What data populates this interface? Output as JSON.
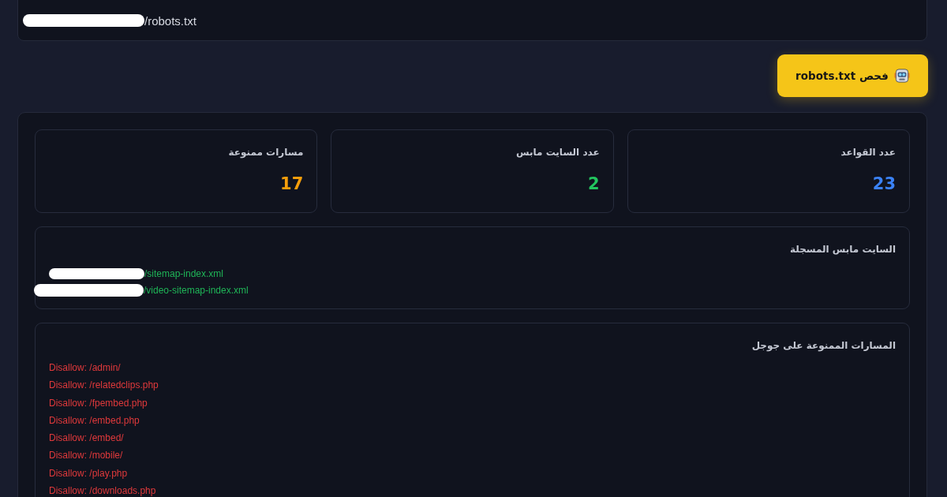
{
  "url_field": {
    "value": "/robots.txt"
  },
  "check_button": {
    "label": "فحص robots.txt"
  },
  "stats": [
    {
      "label": "عدد القواعد",
      "value": "23",
      "color": "#3b82f6"
    },
    {
      "label": "عدد السايت مابس",
      "value": "2",
      "color": "#22c55e"
    },
    {
      "label": "مسارات ممنوعة",
      "value": "17",
      "color": "#f59e0b"
    }
  ],
  "sitemaps": {
    "title": "السايت مابس المسجلة",
    "items": [
      "/sitemap-index.xml",
      "/video-sitemap-index.xml"
    ]
  },
  "disallowed": {
    "title": "المسارات الممنوعة على جوجل",
    "items": [
      "Disallow: /admin/",
      "Disallow: /relatedclips.php",
      "Disallow: /fpembed.php",
      "Disallow: /embed.php",
      "Disallow: /embed/",
      "Disallow: /mobile/",
      "Disallow: /play.php",
      "Disallow: /downloads.php"
    ]
  }
}
